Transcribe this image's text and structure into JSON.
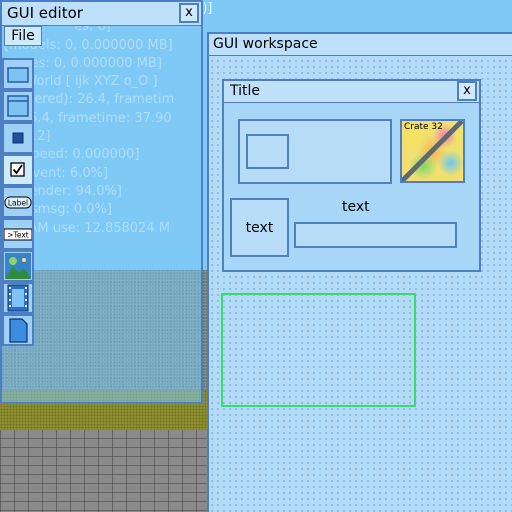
{
  "debug_overlay": {
    "lines": [
      "                                              2)]",
      "                 es: 8]",
      "[models: 0, 0.000000 MB]",
      "  tures: 0, 0.000000 MB]",
      "  o World [ ijk XYZ o_O ]",
      "  (filtered): 26.4, frametim",
      "  : 26.4, frametime: 37.90",
      "  1812]",
      "  n speed: 0.000000]",
      "  e.event: 6.0%]",
      "  e.render: 94.0%]",
      "  .sysmsg: 0.0%]",
      "  l RAM use: 12.858024 M"
    ]
  },
  "gui_editor": {
    "title": "GUI editor",
    "close_label": "x",
    "file_menu": "File",
    "tools": [
      {
        "name": "window-tool",
        "icon": "window-icon"
      },
      {
        "name": "panel-tool",
        "icon": "panel-icon"
      },
      {
        "name": "button-tool",
        "icon": "button-icon"
      },
      {
        "name": "checkbox-tool",
        "icon": "checkbox-icon",
        "glyph": "☑"
      },
      {
        "name": "label-tool",
        "icon": "label-icon",
        "text": "Label"
      },
      {
        "name": "textbox-tool",
        "icon": "textbox-icon",
        "text": ">Text"
      },
      {
        "name": "image-tool",
        "icon": "image-icon"
      },
      {
        "name": "film-tool",
        "icon": "film-icon"
      },
      {
        "name": "page-tool",
        "icon": "page-icon"
      }
    ]
  },
  "gui_workspace": {
    "title": "GUI workspace",
    "window": {
      "title": "Title",
      "close_label": "x",
      "crate_label": "Crate 32",
      "static_text_label": "text",
      "button_label": "text"
    }
  },
  "colors": {
    "sky": "#7ec9f6",
    "panel_border": "#4f7fc3",
    "selection": "#3ed873"
  }
}
